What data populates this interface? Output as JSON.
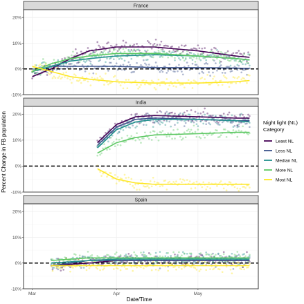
{
  "chart_data": {
    "type": "line",
    "xlabel": "Date/Time",
    "ylabel": "Percent Change in FB population",
    "x_ticks": [
      "Mar",
      "Apr",
      "May"
    ],
    "y_ticks": [
      "-10%",
      "0%",
      "10%",
      "20%"
    ],
    "ylim": [
      -10,
      23
    ],
    "reference_line": 0,
    "legend": {
      "title_line1": "Night light (NL)",
      "title_line2": "Category",
      "position": "right"
    },
    "categories": [
      "Least NL",
      "Less NL",
      "Median NL",
      "More NL",
      "Most NL"
    ],
    "colors": {
      "Least NL": "#440154",
      "Less NL": "#3b528b",
      "Median NL": "#21908d",
      "More NL": "#5dc863",
      "Most NL": "#fde725"
    },
    "panels": [
      {
        "title": "France",
        "series": [
          {
            "name": "Least NL",
            "x": [
              "2020-03-01",
              "2020-03-08",
              "2020-03-15",
              "2020-03-22",
              "2020-04-01",
              "2020-04-15",
              "2020-05-01",
              "2020-05-15",
              "2020-05-20"
            ],
            "values": [
              -3,
              0,
              4,
              7,
              8.5,
              8.5,
              7,
              5,
              4.5
            ]
          },
          {
            "name": "Less NL",
            "x": [
              "2020-03-01",
              "2020-03-08",
              "2020-03-15",
              "2020-03-22",
              "2020-04-01",
              "2020-04-15",
              "2020-05-01",
              "2020-05-15",
              "2020-05-20"
            ],
            "values": [
              -1,
              1,
              1,
              1,
              1,
              0.5,
              0.5,
              0.3,
              0.2
            ]
          },
          {
            "name": "Median NL",
            "x": [
              "2020-03-01",
              "2020-03-08",
              "2020-03-15",
              "2020-03-22",
              "2020-04-01",
              "2020-04-15",
              "2020-05-01",
              "2020-05-15",
              "2020-05-20"
            ],
            "values": [
              -1,
              1,
              3,
              4,
              5,
              5.5,
              5,
              4,
              3.5
            ]
          },
          {
            "name": "More NL",
            "x": [
              "2020-03-01",
              "2020-03-08",
              "2020-03-15",
              "2020-03-22",
              "2020-04-01",
              "2020-04-15",
              "2020-05-01",
              "2020-05-15",
              "2020-05-20"
            ],
            "values": [
              -1,
              2,
              4,
              5,
              6,
              6,
              5,
              4,
              3.5
            ]
          },
          {
            "name": "Most NL",
            "x": [
              "2020-03-01",
              "2020-03-08",
              "2020-03-15",
              "2020-03-22",
              "2020-04-01",
              "2020-04-15",
              "2020-05-01",
              "2020-05-15",
              "2020-05-20"
            ],
            "values": [
              1,
              -1,
              -3,
              -4,
              -5,
              -5.5,
              -5.5,
              -5,
              -4.5
            ]
          }
        ]
      },
      {
        "title": "India",
        "series": [
          {
            "name": "Least NL",
            "x": [
              "2020-03-25",
              "2020-04-01",
              "2020-04-08",
              "2020-04-15",
              "2020-05-01",
              "2020-05-15",
              "2020-05-20"
            ],
            "values": [
              9,
              16,
              19,
              19.5,
              19,
              18.5,
              18.5
            ]
          },
          {
            "name": "Less NL",
            "x": [
              "2020-03-25",
              "2020-04-01",
              "2020-04-08",
              "2020-04-15",
              "2020-05-01",
              "2020-05-15",
              "2020-05-20"
            ],
            "values": [
              8,
              15,
              18,
              18.5,
              18,
              17.5,
              17.5
            ]
          },
          {
            "name": "Median NL",
            "x": [
              "2020-03-25",
              "2020-04-01",
              "2020-04-08",
              "2020-04-15",
              "2020-05-01",
              "2020-05-15",
              "2020-05-20"
            ],
            "values": [
              7,
              14,
              17,
              18,
              18,
              17.5,
              17
            ]
          },
          {
            "name": "More NL",
            "x": [
              "2020-03-25",
              "2020-04-01",
              "2020-04-08",
              "2020-04-15",
              "2020-05-01",
              "2020-05-15",
              "2020-05-20"
            ],
            "values": [
              5,
              9,
              11,
              12,
              12.5,
              13,
              13
            ]
          },
          {
            "name": "Most NL",
            "x": [
              "2020-03-25",
              "2020-04-01",
              "2020-04-08",
              "2020-04-15",
              "2020-05-01",
              "2020-05-15",
              "2020-05-20"
            ],
            "values": [
              -1,
              -5,
              -6.5,
              -7,
              -7,
              -7,
              -7
            ]
          }
        ]
      },
      {
        "title": "Spain",
        "series": [
          {
            "name": "Least NL",
            "x": [
              "2020-03-08",
              "2020-03-22",
              "2020-04-01",
              "2020-04-15",
              "2020-05-01",
              "2020-05-20"
            ],
            "values": [
              -1,
              0,
              1,
              1,
              1,
              1
            ]
          },
          {
            "name": "Less NL",
            "x": [
              "2020-03-08",
              "2020-03-22",
              "2020-04-01",
              "2020-04-15",
              "2020-05-01",
              "2020-05-20"
            ],
            "values": [
              -1,
              1,
              1,
              1,
              1,
              1
            ]
          },
          {
            "name": "Median NL",
            "x": [
              "2020-03-08",
              "2020-03-22",
              "2020-04-01",
              "2020-04-15",
              "2020-05-01",
              "2020-05-20"
            ],
            "values": [
              0,
              1,
              1.5,
              1.5,
              1.5,
              1.5
            ]
          },
          {
            "name": "More NL",
            "x": [
              "2020-03-08",
              "2020-03-22",
              "2020-04-01",
              "2020-04-15",
              "2020-05-01",
              "2020-05-20"
            ],
            "values": [
              1,
              2,
              2,
              2,
              2,
              2
            ]
          },
          {
            "name": "Most NL",
            "x": [
              "2020-03-08",
              "2020-03-22",
              "2020-04-01",
              "2020-04-15",
              "2020-05-01",
              "2020-05-20"
            ],
            "values": [
              -1,
              -1,
              -1,
              -1,
              -1,
              -1
            ]
          }
        ]
      }
    ]
  }
}
